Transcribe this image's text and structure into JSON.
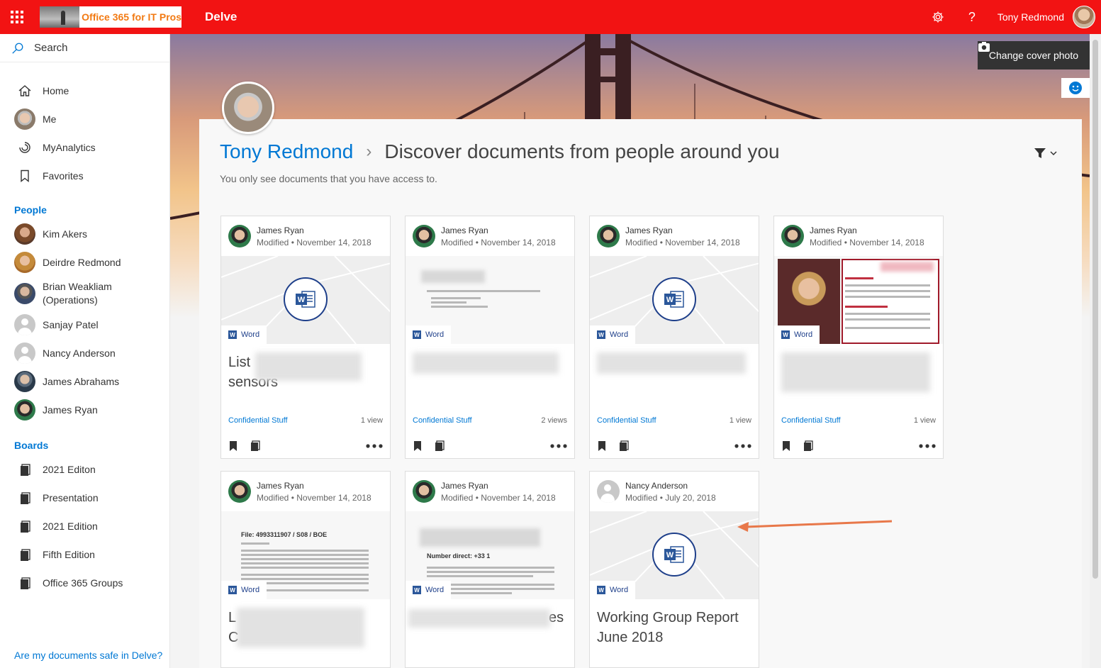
{
  "topbar": {
    "org_name": "Office 365 for IT Pros",
    "app_name": "Delve",
    "user_name": "Tony Redmond",
    "color": "#f21313"
  },
  "sidebar": {
    "search_placeholder": "Search",
    "nav": [
      {
        "label": "Home",
        "icon": "home-icon"
      },
      {
        "label": "Me",
        "icon": "avatar"
      },
      {
        "label": "MyAnalytics",
        "icon": "analytics-icon"
      },
      {
        "label": "Favorites",
        "icon": "bookmark-icon"
      }
    ],
    "people_title": "People",
    "people": [
      {
        "label": "Kim Akers"
      },
      {
        "label": "Deirdre Redmond"
      },
      {
        "label": "Brian Weakliam (Operations)"
      },
      {
        "label": "Sanjay Patel"
      },
      {
        "label": "Nancy Anderson"
      },
      {
        "label": "James Abrahams"
      },
      {
        "label": "James Ryan"
      }
    ],
    "boards_title": "Boards",
    "boards": [
      {
        "label": "2021 Editon"
      },
      {
        "label": "Presentation"
      },
      {
        "label": "2021 Edition"
      },
      {
        "label": "Fifth Edition"
      },
      {
        "label": "Office 365 Groups"
      }
    ],
    "footer_link": "Are my documents safe in Delve?"
  },
  "main": {
    "change_cover": "Change cover photo",
    "profile_name": "Tony Redmond",
    "page_title": "Discover documents from people around you",
    "subtext": "You only see documents that you have access to."
  },
  "cards": [
    {
      "author": "James Ryan",
      "modified": "Modified • November 14, 2018",
      "type": "Word",
      "title": "List\nsensors",
      "site": "Confidential Stuff",
      "views": "1 view"
    },
    {
      "author": "James Ryan",
      "modified": "Modified • November 14, 2018",
      "type": "Word",
      "title": "",
      "site": "Confidential Stuff",
      "views": "2 views"
    },
    {
      "author": "James Ryan",
      "modified": "Modified • November 14, 2018",
      "type": "Word",
      "title": "",
      "site": "Confidential Stuff",
      "views": "1 view"
    },
    {
      "author": "James Ryan",
      "modified": "Modified • November 14, 2018",
      "type": "Word",
      "title": "",
      "site": "Confidential Stuff",
      "views": "1 view"
    },
    {
      "author": "James Ryan",
      "modified": "Modified • November 14, 2018",
      "type": "Word",
      "title": "L\nC",
      "site": "",
      "views": "",
      "preview_heading": "File: 4993311907 / S08 / BOE"
    },
    {
      "author": "James Ryan",
      "modified": "Modified • November 14, 2018",
      "type": "Word",
      "title": "es",
      "site": "",
      "views": "",
      "preview_heading": "Number direct: +33 1"
    },
    {
      "author": "Nancy Anderson",
      "modified": "Modified • July 20, 2018",
      "type": "Word",
      "title": "Working Group Report June 2018",
      "site": "",
      "views": ""
    }
  ]
}
